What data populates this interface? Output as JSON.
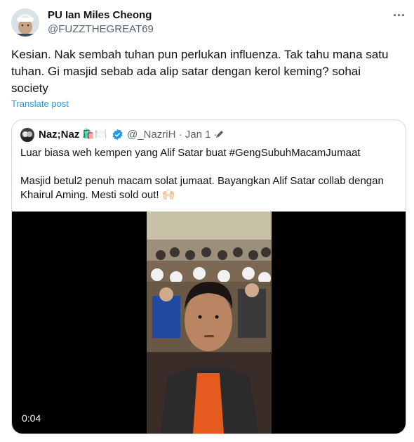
{
  "author": {
    "name": "PU Ian Miles Cheong",
    "handle": "@FUZZTHEGREAT69"
  },
  "tweet": {
    "text": "Kesian. Nak sembah tuhan pun perlukan influenza. Tak tahu mana satu tuhan. Gi masjid sebab ada alip satar dengan kerol keming? sohai society",
    "translate_label": "Translate post"
  },
  "quote": {
    "name": "Naz;Naz",
    "emoji": "🛍️🍽️",
    "handle_date": "@_NazriH · Jan 1 ·",
    "line1": "Luar biasa weh kempen yang Alif Satar buat #GengSubuhMacamJumaat",
    "line2": "Masjid betul2 penuh macam solat jumaat. Bayangkan Alif Satar collab dengan Khairul Aming. Mesti sold out! 🙌🏻",
    "video_time": "0:04"
  },
  "colors": {
    "link": "#1d9bf0",
    "secondary": "#536471",
    "verified": "#1d9bf0"
  },
  "icons": [
    "more-icon",
    "verified-icon",
    "edit-pencil-icon"
  ]
}
